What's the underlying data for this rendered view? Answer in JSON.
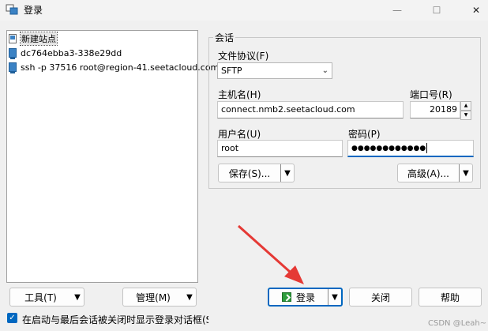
{
  "window": {
    "title": "登录",
    "minimize_glyph": "—",
    "maximize_glyph": "☐",
    "close_glyph": "✕"
  },
  "site_tree": {
    "items": [
      {
        "label": "新建站点",
        "icon": "new-site-icon",
        "selected": true
      },
      {
        "label": "dc764ebba3-338e29dd",
        "icon": "computer-icon",
        "selected": false
      },
      {
        "label": "ssh -p 37516 root@region-41.seetacloud.com",
        "icon": "computer-icon",
        "selected": false
      }
    ]
  },
  "session": {
    "group_label": "会话",
    "protocol_label": "文件协议(F)",
    "protocol_value": "SFTP",
    "host_label": "主机名(H)",
    "host_value": "connect.nmb2.seetacloud.com",
    "port_label": "端口号(R)",
    "port_value": "20189",
    "user_label": "用户名(U)",
    "user_value": "root",
    "password_label": "密码(P)",
    "password_value": "●●●●●●●●●●●●",
    "save_label": "保存(S)...",
    "advanced_label": "高级(A)..."
  },
  "bottom": {
    "tools_label": "工具(T)",
    "manage_label": "管理(M)",
    "login_label": "登录",
    "close_label": "关闭",
    "help_label": "帮助",
    "startup_checkbox_label": "在启动与最后会话被关闭时显示登录对话框(S",
    "startup_checked": true
  },
  "watermark": "CSDN @Leah~",
  "colors": {
    "accent": "#0067c0",
    "annotation_arrow": "#e53935"
  }
}
